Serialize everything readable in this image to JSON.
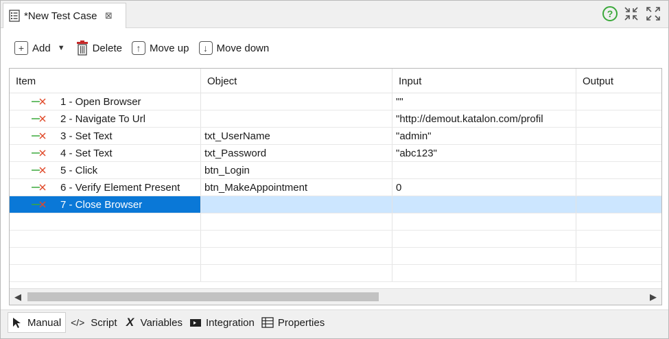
{
  "editor_tab": {
    "title": "*New Test Case",
    "close_glyph": "⊠"
  },
  "toolbar": {
    "add_label": "Add",
    "delete_label": "Delete",
    "move_up_label": "Move up",
    "move_down_label": "Move down"
  },
  "table": {
    "columns": [
      "Item",
      "Object",
      "Input",
      "Output"
    ],
    "rows": [
      {
        "item": "1 - Open Browser",
        "object": "",
        "input": "\"\"",
        "output": ""
      },
      {
        "item": "2 - Navigate To Url",
        "object": "",
        "input": "\"http://demout.katalon.com/profil",
        "output": ""
      },
      {
        "item": "3 - Set Text",
        "object": "txt_UserName",
        "input": "\"admin\"",
        "output": ""
      },
      {
        "item": "4 - Set Text",
        "object": "txt_Password",
        "input": "\"abc123\"",
        "output": ""
      },
      {
        "item": "5 - Click",
        "object": "btn_Login",
        "input": "",
        "output": ""
      },
      {
        "item": "6 - Verify Element Present",
        "object": "btn_MakeAppointment",
        "input": "0",
        "output": ""
      },
      {
        "item": "7 - Close Browser",
        "object": "",
        "input": "",
        "output": ""
      }
    ],
    "selected_row": 7
  },
  "bottom_tabs": {
    "manual": "Manual",
    "script": "Script",
    "variables": "Variables",
    "integration": "Integration",
    "properties": "Properties"
  },
  "colors": {
    "selection": "#0a78d7",
    "selection_row": "#cce6ff",
    "help_green": "#3aa83a",
    "step_icon_green": "#3aa83a",
    "step_icon_red": "#e04a2a"
  }
}
